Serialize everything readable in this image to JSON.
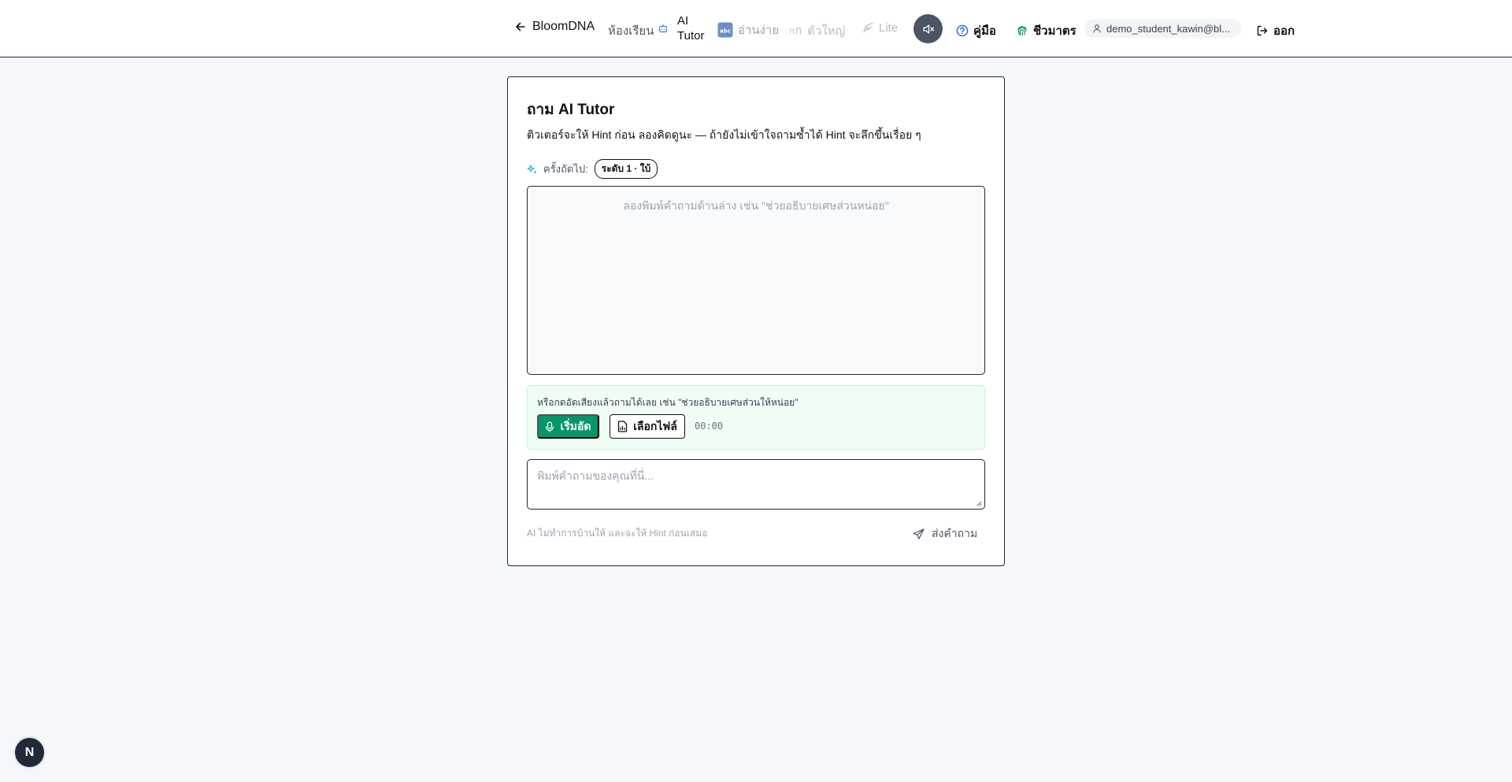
{
  "header": {
    "back_label": "BloomDNA",
    "classroom_label": "ห้องเรียน",
    "aitutor_line1": "AI",
    "aitutor_line2": "Tutor",
    "easy_read_label": "อ่านง่าย",
    "big_text_label": "ตัวใหญ่",
    "big_text_glyph": "ก",
    "lite_label": "Lite",
    "guide_label": "คู่มือ",
    "bio_label": "ชีวมาตร",
    "user_label": "demo_student_kawin@bl...",
    "logout_label": "ออก"
  },
  "card": {
    "title": "ถาม AI Tutor",
    "subtitle": "ติวเตอร์จะให้ Hint ก่อน ลองคิดดูนะ — ถ้ายังไม่เข้าใจถามซ้ำได้ Hint จะลึกขึ้นเรื่อย ๆ",
    "next_label": "ครั้งถัดไป:",
    "level_badge": "ระดับ 1 · ใบ้",
    "chat_placeholder": "ลองพิมพ์คำถามด้านล่าง เช่น \"ช่วยอธิบายเศษส่วนหน่อย\"",
    "voice_hint": "หรือกดอัดเสียงแล้วถามได้เลย เช่น \"ช่วยอธิบายเศษส่วนให้หน่อย\"",
    "record_label": "เริ่มอัด",
    "file_label": "เลือกไฟล์",
    "timer": "00:00",
    "question_placeholder": "พิมพ์คำถามของคุณที่นี่...",
    "question_value": "",
    "footer_note": "AI ไม่ทำการบ้านให้ และจะให้ Hint ก่อนเสมอ",
    "send_label": "ส่งคำถาม"
  },
  "floating": {
    "badge_letter": "N"
  },
  "colors": {
    "accent_green": "#059669",
    "voice_bg": "#f0fdf4",
    "header_dark": "#4b5563"
  },
  "icons": [
    "arrow-left-icon",
    "robot-icon",
    "abc-icon",
    "feather-icon",
    "speaker-mute-icon",
    "help-circle-icon",
    "fingerprint-icon",
    "user-icon",
    "logout-icon",
    "sparkles-icon",
    "mic-icon",
    "file-icon",
    "send-icon"
  ]
}
